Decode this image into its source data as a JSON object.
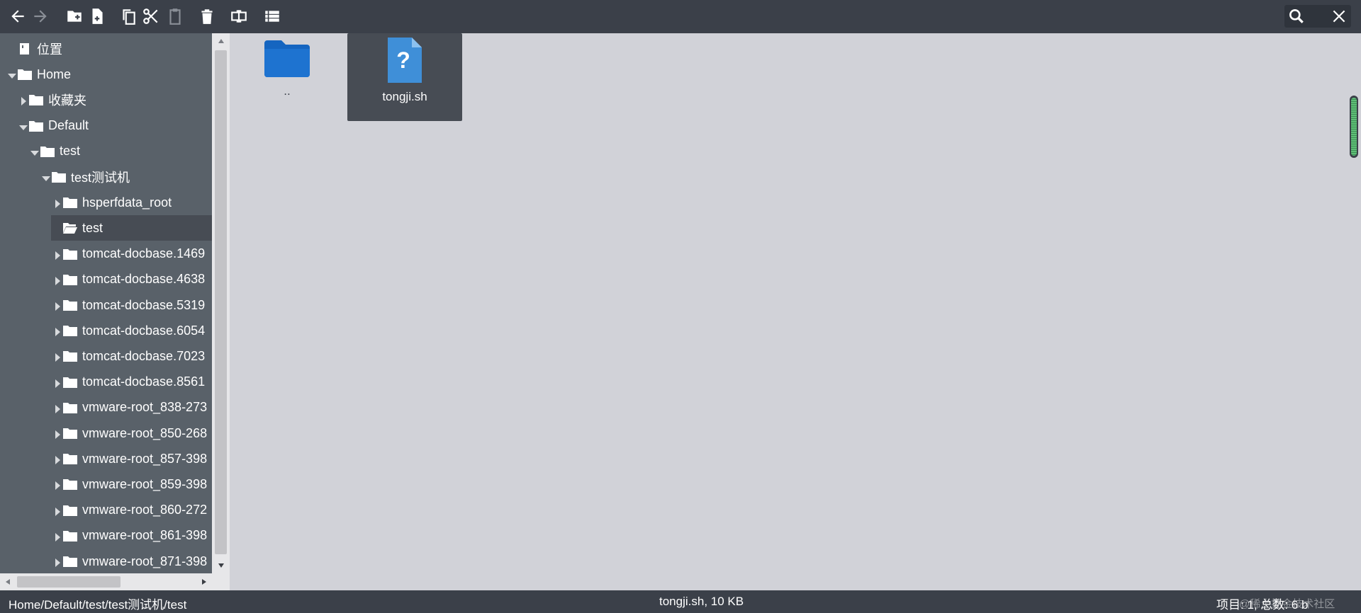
{
  "toolbar": {
    "buttons": [
      {
        "name": "back-button",
        "icon": "arrow-left-icon"
      },
      {
        "name": "forward-button",
        "icon": "arrow-right-icon"
      },
      {
        "name": "new-folder-button",
        "icon": "folder-plus-icon"
      },
      {
        "name": "new-file-button",
        "icon": "file-plus-icon"
      },
      {
        "name": "copy-button",
        "icon": "copy-icon"
      },
      {
        "name": "cut-button",
        "icon": "scissors-icon"
      },
      {
        "name": "paste-button",
        "icon": "clipboard-icon"
      },
      {
        "name": "delete-button",
        "icon": "trash-icon"
      },
      {
        "name": "rename-button",
        "icon": "rename-icon"
      },
      {
        "name": "view-mode-button",
        "icon": "list-icon"
      }
    ],
    "search": {
      "value": "",
      "placeholder": ""
    }
  },
  "sidebar": {
    "tree": [
      {
        "label": "位置",
        "icon": "location-book-icon",
        "arrow": "none",
        "level": 0
      },
      {
        "label": "Home",
        "icon": "home-folder-icon",
        "arrow": "down",
        "level": 0
      },
      {
        "label": "收藏夹",
        "icon": "folder-icon",
        "arrow": "right",
        "level": 1
      },
      {
        "label": "Default",
        "icon": "folder-icon",
        "arrow": "down",
        "level": 1
      },
      {
        "label": "test",
        "icon": "folder-icon",
        "arrow": "down",
        "level": 2
      },
      {
        "label": "test测试机",
        "icon": "folder-icon",
        "arrow": "down",
        "level": 3
      },
      {
        "label": "hsperfdata_root",
        "icon": "folder-icon",
        "arrow": "right",
        "level": 4
      },
      {
        "label": "test",
        "icon": "folder-open-icon",
        "arrow": "none",
        "level": 4,
        "selected": true
      },
      {
        "label": "tomcat-docbase.1469",
        "icon": "folder-icon",
        "arrow": "right",
        "level": 4
      },
      {
        "label": "tomcat-docbase.4638",
        "icon": "folder-icon",
        "arrow": "right",
        "level": 4
      },
      {
        "label": "tomcat-docbase.5319",
        "icon": "folder-icon",
        "arrow": "right",
        "level": 4
      },
      {
        "label": "tomcat-docbase.6054",
        "icon": "folder-icon",
        "arrow": "right",
        "level": 4
      },
      {
        "label": "tomcat-docbase.7023",
        "icon": "folder-icon",
        "arrow": "right",
        "level": 4
      },
      {
        "label": "tomcat-docbase.8561",
        "icon": "folder-icon",
        "arrow": "right",
        "level": 4
      },
      {
        "label": "vmware-root_838-273",
        "icon": "folder-icon",
        "arrow": "right",
        "level": 4
      },
      {
        "label": "vmware-root_850-268",
        "icon": "folder-icon",
        "arrow": "right",
        "level": 4
      },
      {
        "label": "vmware-root_857-398",
        "icon": "folder-icon",
        "arrow": "right",
        "level": 4
      },
      {
        "label": "vmware-root_859-398",
        "icon": "folder-icon",
        "arrow": "right",
        "level": 4
      },
      {
        "label": "vmware-root_860-272",
        "icon": "folder-icon",
        "arrow": "right",
        "level": 4
      },
      {
        "label": "vmware-root_861-398",
        "icon": "folder-icon",
        "arrow": "right",
        "level": 4
      },
      {
        "label": "vmware-root_871-398",
        "icon": "folder-icon",
        "arrow": "right",
        "level": 4
      }
    ]
  },
  "main": {
    "items": [
      {
        "name": "..",
        "type": "parent-folder",
        "icon": "folder-icon"
      },
      {
        "name": "tongji.sh",
        "type": "file",
        "icon": "unknown-file-icon",
        "selected": true
      }
    ]
  },
  "status": {
    "path": "Home/Default/test/test测试机/test",
    "selected_file": "tongji.sh, 10 KB",
    "count": "项目: 1,   总数: 6 b",
    "watermark": "@稀土掘金技术社区"
  },
  "colors": {
    "toolbar_bg": "#3b4049",
    "sidebar_bg": "#596169",
    "main_bg": "#d1d2d8",
    "selected_bg": "#474c54",
    "folder_blue": "#1565c0",
    "file_blue": "#3f8fd8",
    "overview_green": "#5fbf77"
  }
}
